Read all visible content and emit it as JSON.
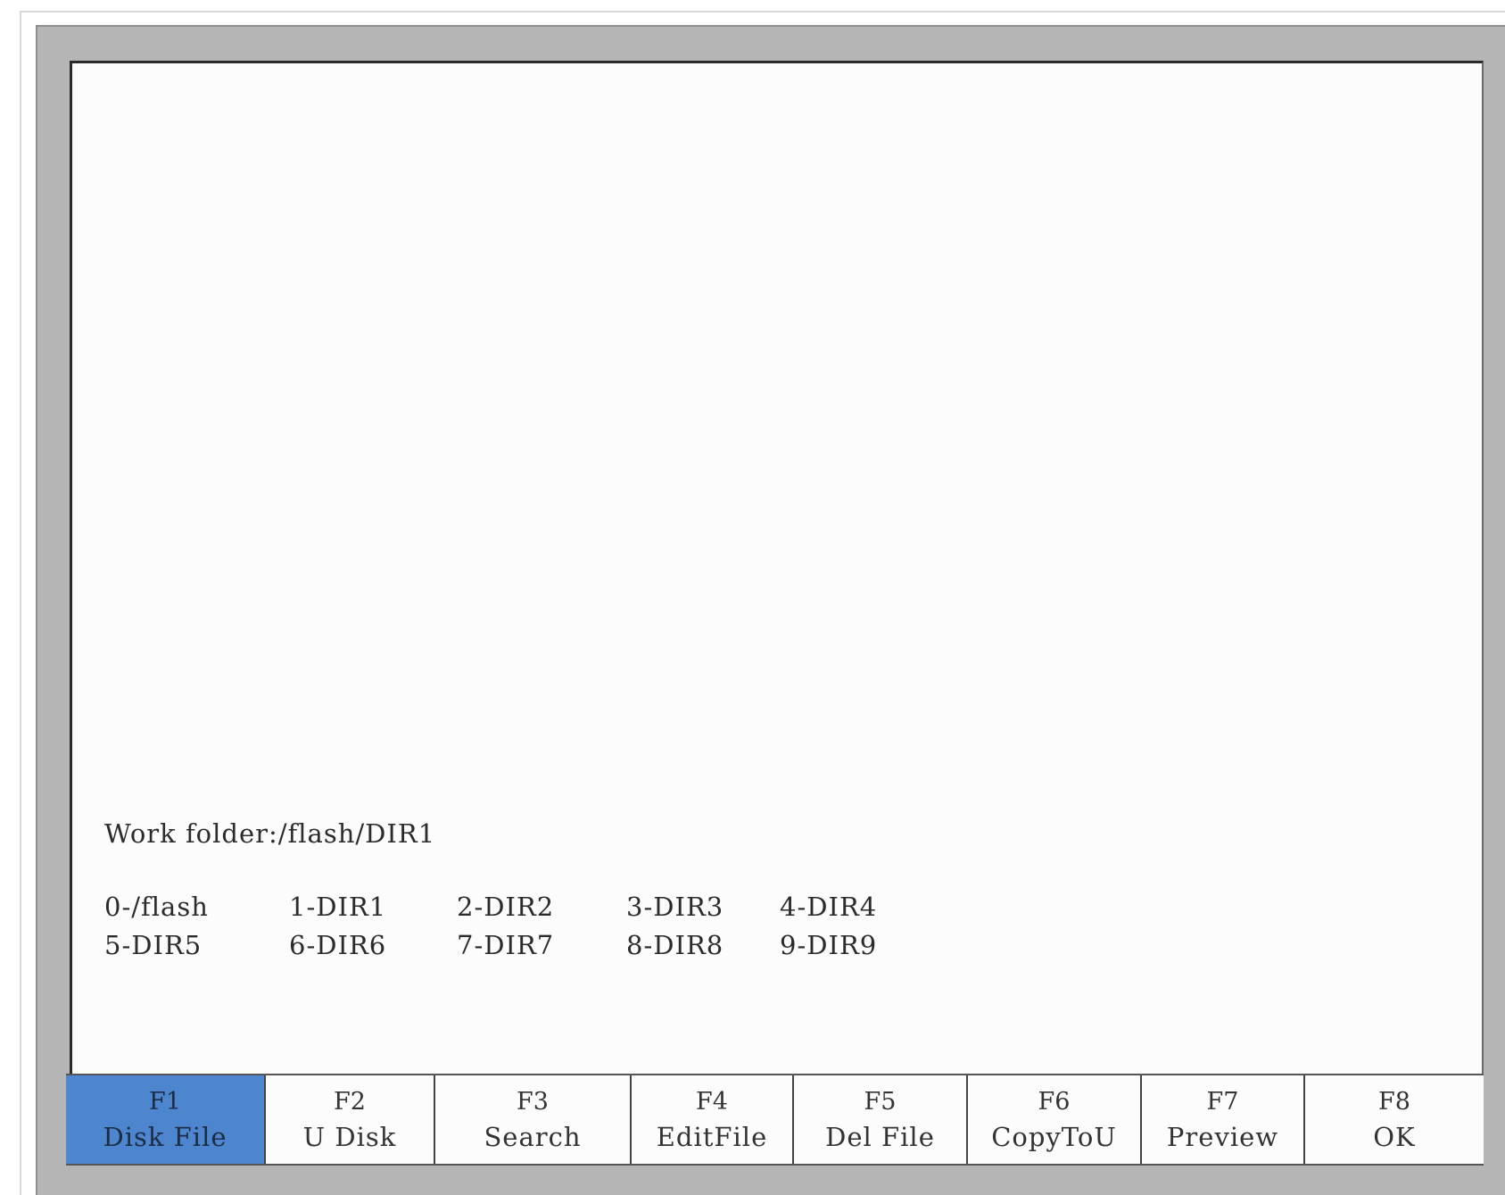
{
  "work_folder": {
    "label": "Work folder:",
    "path": "/flash/DIR1"
  },
  "directories": [
    [
      "0-/flash",
      "1-DIR1",
      "2-DIR2",
      "3-DIR3",
      "4-DIR4"
    ],
    [
      "5-DIR5",
      "6-DIR6",
      "7-DIR7",
      "8-DIR8",
      "9-DIR9"
    ]
  ],
  "function_keys": [
    {
      "key": "F1",
      "label": "Disk File",
      "active": true
    },
    {
      "key": "F2",
      "label": "U Disk",
      "active": false
    },
    {
      "key": "F3",
      "label": "Search",
      "active": false
    },
    {
      "key": "F4",
      "label": "EditFile",
      "active": false
    },
    {
      "key": "F5",
      "label": "Del File",
      "active": false
    },
    {
      "key": "F6",
      "label": "CopyToU",
      "active": false
    },
    {
      "key": "F7",
      "label": "Preview",
      "active": false
    },
    {
      "key": "F8",
      "label": "OK",
      "active": false
    }
  ],
  "colors": {
    "active_key": "#4d86cf",
    "bezel": "#b5b5b5",
    "screen": "#fcfcfc"
  }
}
